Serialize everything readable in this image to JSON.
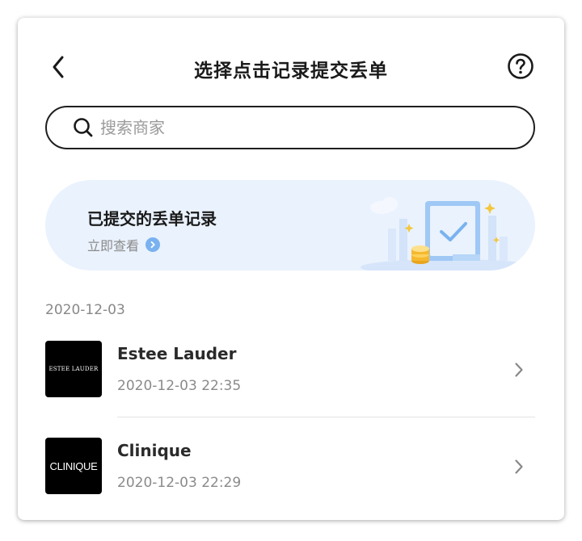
{
  "header": {
    "title": "选择点击记录提交丢单"
  },
  "search": {
    "placeholder": "搜索商家"
  },
  "banner": {
    "title": "已提交的丢单记录",
    "link_label": "立即查看"
  },
  "list": {
    "date": "2020-12-03",
    "items": [
      {
        "name": "Estee Lauder",
        "time": "2020-12-03 22:35",
        "logo_text": "ESTEE LAUDER"
      },
      {
        "name": "Clinique",
        "time": "2020-12-03 22:29",
        "logo_text": "CLINIQUE"
      }
    ]
  },
  "icons": {
    "back": "chevron-left-icon",
    "help": "question-circle-icon",
    "search": "search-icon",
    "row_arrow": "chevron-right-icon"
  },
  "colors": {
    "banner_bg": "#eaf2fd",
    "accent_blue": "#7ab2f0",
    "text_primary": "#1a1a1a",
    "text_secondary": "#8a8a8a"
  }
}
